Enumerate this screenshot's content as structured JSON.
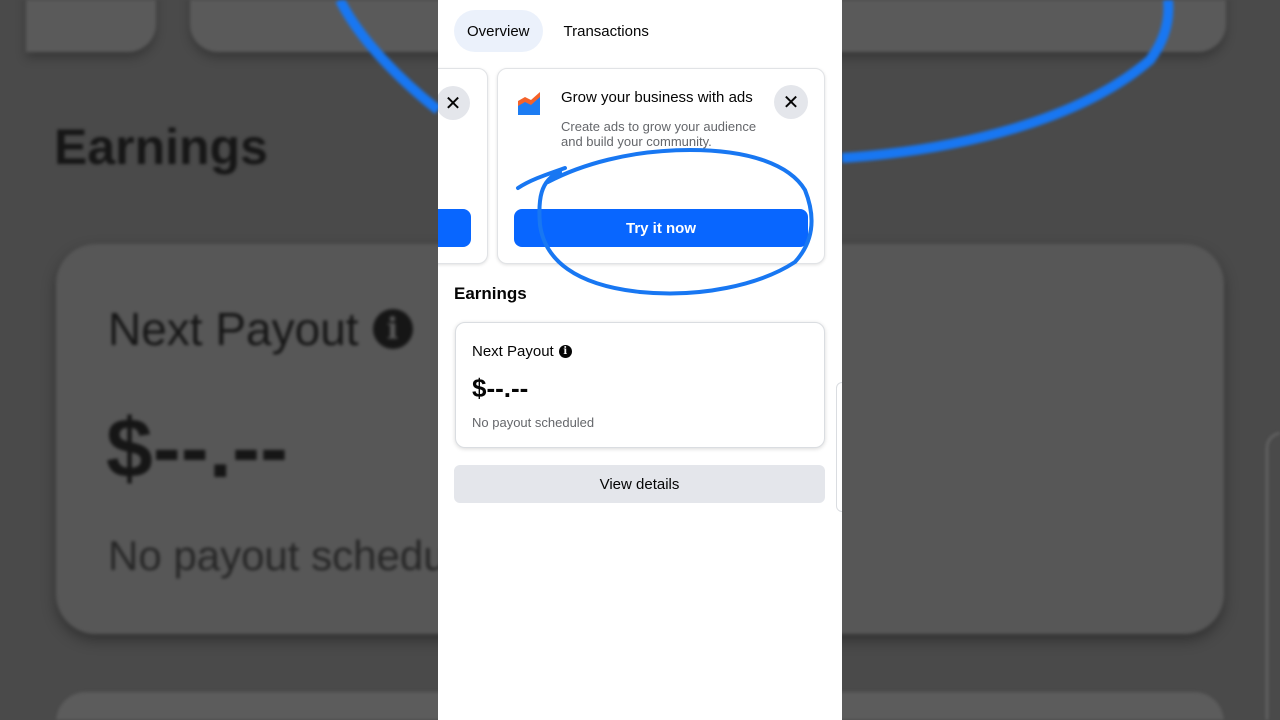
{
  "tabs": [
    {
      "label": "Overview",
      "active": true
    },
    {
      "label": "Transactions",
      "active": false
    }
  ],
  "ad_card": {
    "title": "Grow your business with ads",
    "description": "Create ads to grow your audience and build your community.",
    "button_label": "Try it now",
    "icon": "ads-chart-icon",
    "close_icon": "close-icon"
  },
  "earnings": {
    "section_title": "Earnings",
    "next_payout_label": "Next Payout",
    "info_icon": "info-icon",
    "amount": "$--.--",
    "status": "No payout scheduled",
    "view_details_label": "View details"
  },
  "background_mirror": {
    "title": "Earnings",
    "next_payout_label": "Next Payout",
    "amount": "$--.--",
    "status": "No payout schedu"
  },
  "colors": {
    "primary_button": "#0866ff",
    "annotation_stroke": "#1877f2",
    "secondary_button": "#e4e6eb",
    "active_tab": "#ebf1fb"
  }
}
